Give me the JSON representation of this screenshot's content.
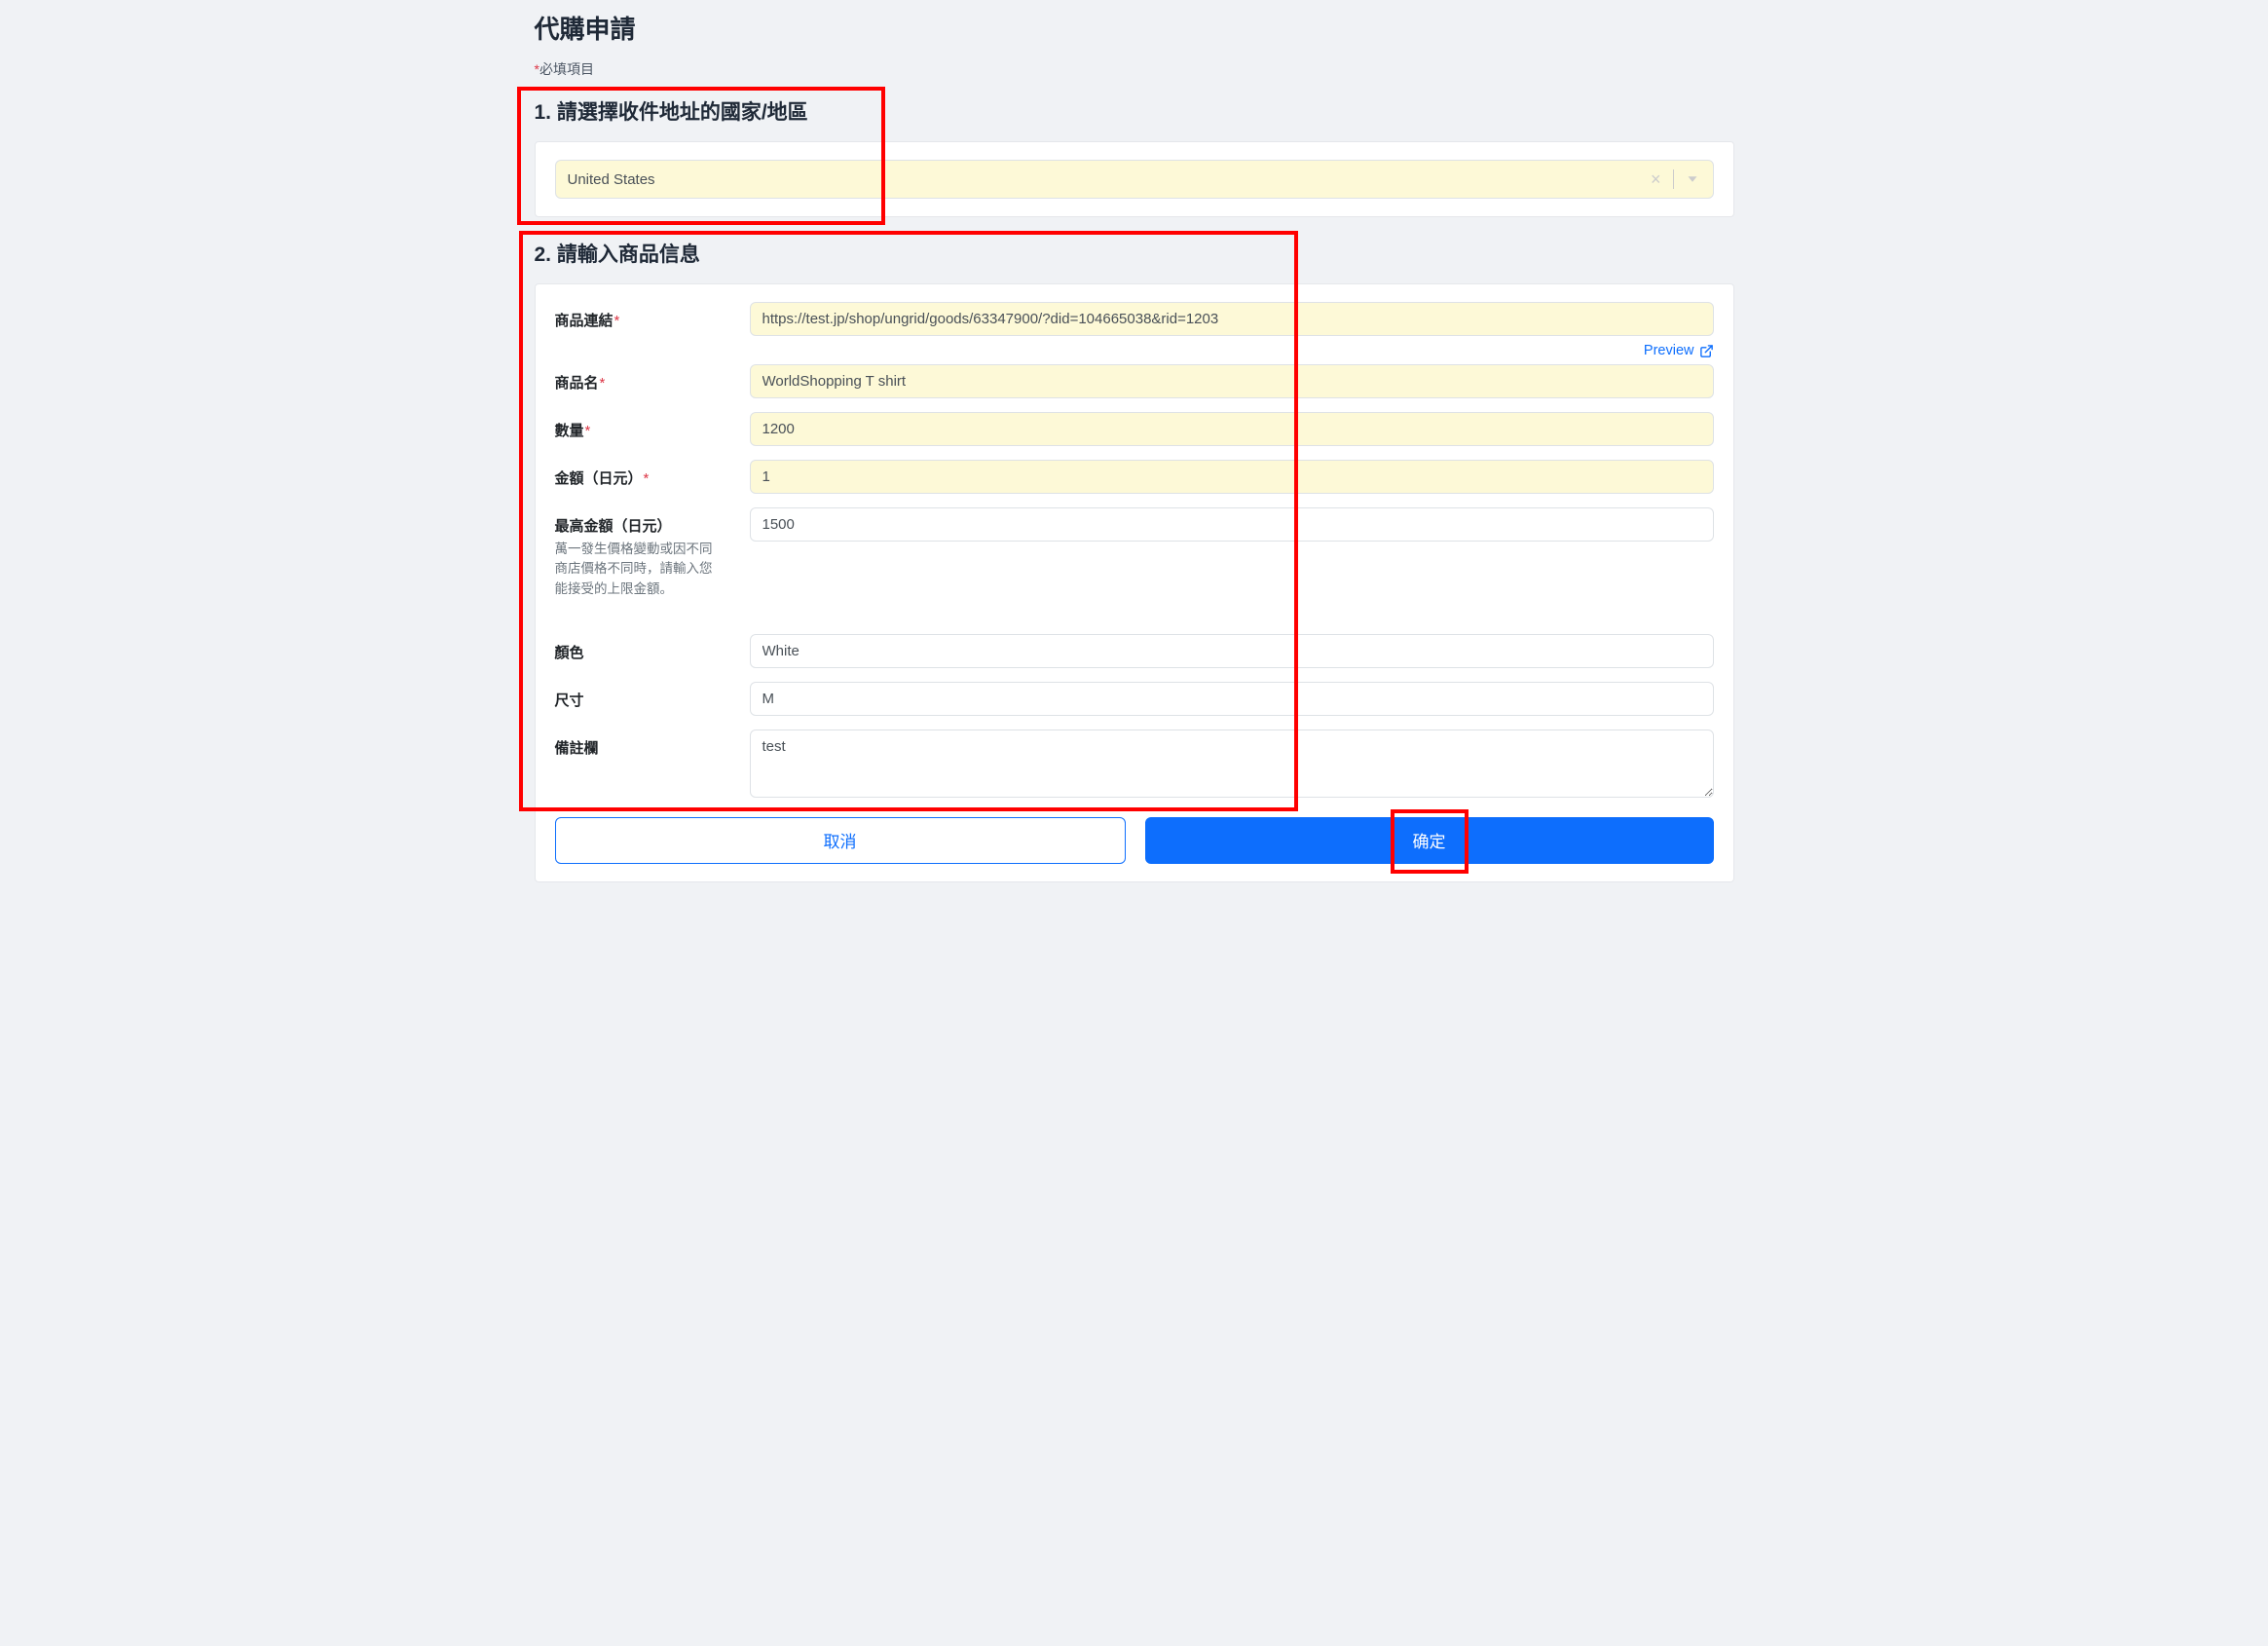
{
  "header": {
    "title": "代購申請",
    "required_asterisk": "*",
    "required_text": "必填項目"
  },
  "section1": {
    "title": "1. 請選擇收件地址的國家/地區",
    "country_value": "United States"
  },
  "section2": {
    "title": "2. 請輸入商品信息",
    "labels": {
      "product_link": "商品連結",
      "product_name": "商品名",
      "quantity": "數量",
      "amount": "金額（日元）",
      "max_amount": "最高金額（日元）",
      "max_amount_help": "萬一發生價格變動或因不同商店價格不同時，請輸入您能接受的上限金額。",
      "color": "顏色",
      "size": "尺寸",
      "remark": "備註欄"
    },
    "values": {
      "product_link": "https://test.jp/shop/ungrid/goods/63347900/?did=104665038&rid=1203",
      "product_name": "WorldShopping T shirt",
      "quantity": "1200",
      "amount": "1",
      "max_amount": "1500",
      "color": "White",
      "size": "M",
      "remark": "test"
    },
    "preview_label": "Preview"
  },
  "buttons": {
    "cancel": "取消",
    "confirm": "确定"
  }
}
